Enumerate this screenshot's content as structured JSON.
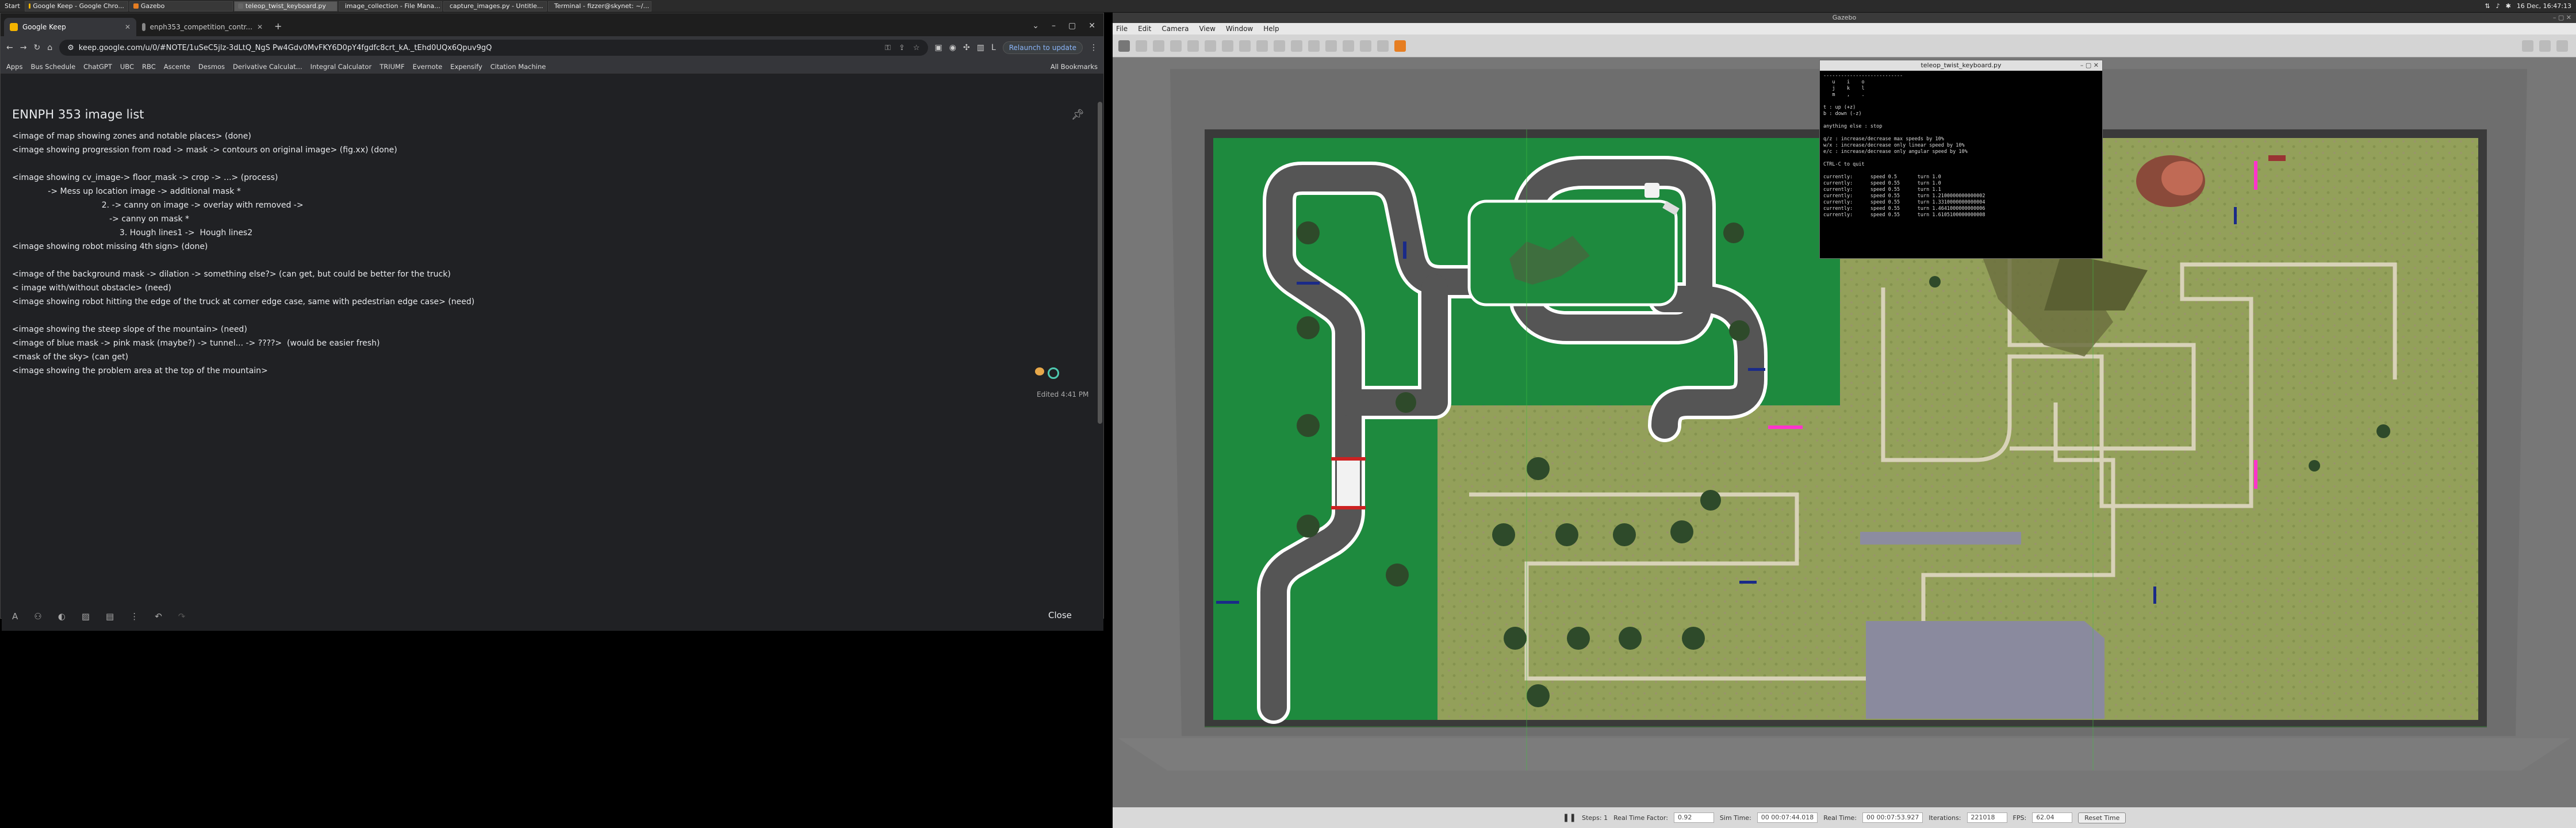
{
  "taskbar": {
    "start": "Start",
    "tasks": [
      {
        "label": "Google Keep - Google Chro...",
        "active": false
      },
      {
        "label": "Gazebo",
        "active": false
      },
      {
        "label": "teleop_twist_keyboard.py",
        "active": true
      },
      {
        "label": "image_collection - File Mana...",
        "active": false
      },
      {
        "label": "capture_images.py - Untitle...",
        "active": false
      },
      {
        "label": "Terminal - fizzer@skynet: ~/...",
        "active": false
      }
    ],
    "clock": "16 Dec, 16:47:13"
  },
  "chrome": {
    "tabs": [
      {
        "label": "Google Keep",
        "active": true
      },
      {
        "label": "enph353_competition_contr...",
        "active": false
      }
    ],
    "url": "keep.google.com/u/0/#NOTE/1uSeC5jlz-3dLtQ_NgS Pw4Gdv0MvFKY6D0pY4fgdfc8crt_kA._tEhd0UQx6Qpuv9gQ",
    "relaunch": "Relaunch to update",
    "bookmarks": [
      "Apps",
      "Bus Schedule",
      "ChatGPT",
      "UBC",
      "RBC",
      "Ascente",
      "Desmos",
      "Derivative Calculat...",
      "Integral Calculator",
      "TRIUMF",
      "Evernote",
      "Expensify",
      "Citation Machine"
    ],
    "all_bookmarks": "All Bookmarks"
  },
  "note": {
    "title": "ENNPH 353 image list",
    "lines": [
      "<image of map showing zones and notable places> (done)",
      "<image showing progression from road -> mask -> contours on original image> (fig.xx) (done)",
      "",
      "<image showing cv_image-> floor_mask -> crop -> ...> (process)",
      "              -> Mess up location image -> additional mask *",
      "                                   2. -> canny on image -> overlay with removed ->",
      "                                      -> canny on mask *",
      "                                          3. Hough lines1 ->  Hough lines2",
      "<image showing robot missing 4th sign> (done)",
      "",
      "<image of the background mask -> dilation -> something else?> (can get, but could be better for the truck)",
      "< image with/without obstacle> (need)",
      "<image showing robot hitting the edge of the truck at corner edge case, same with pedestrian edge case> (need)",
      "",
      "<image showing the steep slope of the mountain> (need)",
      "<image of blue mask -> pink mask (maybe?) -> tunnel... -> ????>  (would be easier fresh)",
      "<mask of the sky> (can get)",
      "<image showing the problem area at the top of the mountain>"
    ],
    "edited": "Edited 4:41 PM",
    "close": "Close",
    "tools": [
      "format-icon",
      "add-collaborator-icon",
      "palette-icon",
      "image-icon",
      "archive-icon",
      "more-icon",
      "undo-icon",
      "redo-icon"
    ]
  },
  "gazebo": {
    "title": "Gazebo",
    "menu": [
      "File",
      "Edit",
      "Camera",
      "View",
      "Window",
      "Help"
    ],
    "status": {
      "steps_label": "Steps: 1",
      "rtf_label": "Real Time Factor:",
      "rtf": "0.92",
      "sim_label": "Sim Time:",
      "sim": "00 00:07:44.018",
      "real_label": "Real Time:",
      "real": "00 00:07:53.927",
      "iter_label": "Iterations:",
      "iter": "221018",
      "fps_label": "FPS:",
      "fps": "62.04",
      "reset": "Reset Time"
    }
  },
  "terminal": {
    "title": "teleop_twist_keyboard.py",
    "lines": [
      "---------------------------",
      "   u    i    o",
      "   j    k    l",
      "   m    ,    .",
      "",
      "t : up (+z)",
      "b : down (-z)",
      "",
      "anything else : stop",
      "",
      "q/z : increase/decrease max speeds by 10%",
      "w/x : increase/decrease only linear speed by 10%",
      "e/c : increase/decrease only angular speed by 10%",
      "",
      "CTRL-C to quit",
      "",
      "currently:      speed 0.5       turn 1.0",
      "currently:      speed 0.55      turn 1.0",
      "currently:      speed 0.55      turn 1.1",
      "currently:      speed 0.55      turn 1.2100000000000002",
      "currently:      speed 0.55      turn 1.3310000000000004",
      "currently:      speed 0.55      turn 1.4641000000000006",
      "currently:      speed 0.55      turn 1.6105100000000008"
    ]
  },
  "colors": {
    "grass": "#1e8a3e",
    "road": "#555555",
    "terrain": "#8f9a55",
    "pink": "#ff33cc",
    "blue": "#1a2a88"
  }
}
